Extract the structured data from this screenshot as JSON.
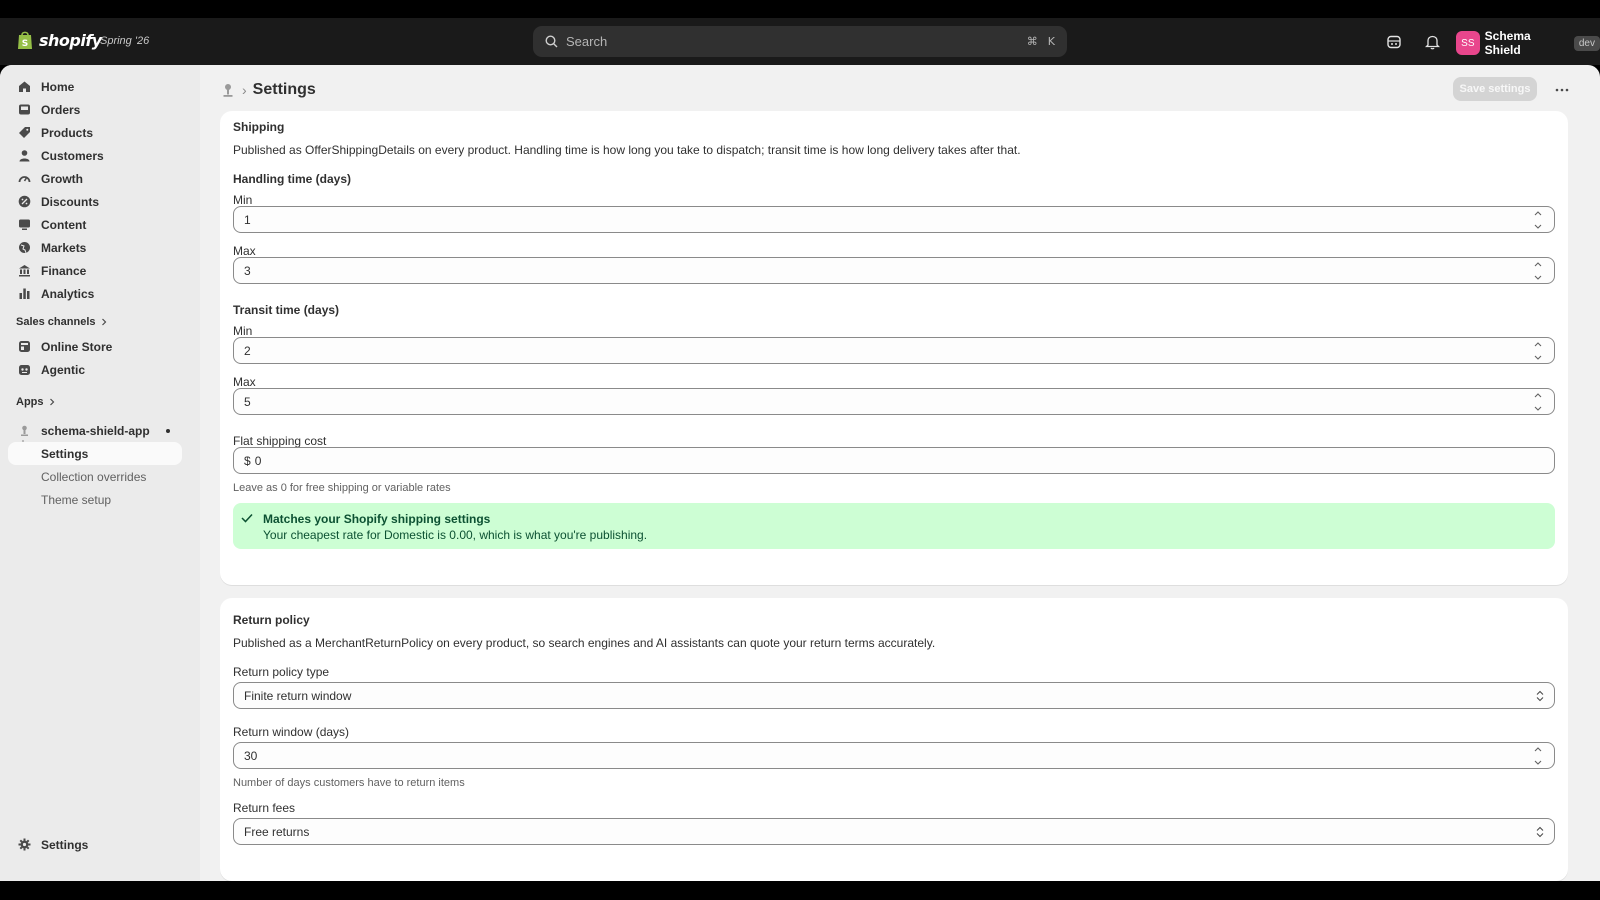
{
  "topbar": {
    "brand": "shopify",
    "edition": "Spring '26",
    "search_placeholder": "Search",
    "shortcut_cmd": "⌘",
    "shortcut_key": "K",
    "user_initials": "SS",
    "user_name": "Schema Shield",
    "user_badge": "dev"
  },
  "sidebar": {
    "items": [
      {
        "label": "Home",
        "icon": "home-icon"
      },
      {
        "label": "Orders",
        "icon": "inbox-icon"
      },
      {
        "label": "Products",
        "icon": "tag-icon"
      },
      {
        "label": "Customers",
        "icon": "person-icon"
      },
      {
        "label": "Growth",
        "icon": "gauge-icon"
      },
      {
        "label": "Discounts",
        "icon": "discount-icon"
      },
      {
        "label": "Content",
        "icon": "monitor-icon"
      },
      {
        "label": "Markets",
        "icon": "globe-icon"
      },
      {
        "label": "Finance",
        "icon": "bank-icon"
      },
      {
        "label": "Analytics",
        "icon": "bar-chart-icon"
      }
    ],
    "sales_channels_label": "Sales channels",
    "channels": [
      {
        "label": "Online Store",
        "icon": "store-icon"
      },
      {
        "label": "Agentic",
        "icon": "robot-icon"
      }
    ],
    "apps_label": "Apps",
    "app_name": "schema-shield-app",
    "app_subitems": [
      "Settings",
      "Collection overrides",
      "Theme setup"
    ],
    "bottom_settings": "Settings"
  },
  "header": {
    "title": "Settings",
    "save_label": "Save settings"
  },
  "shipping": {
    "title": "Shipping",
    "description": "Published as OfferShippingDetails on every product. Handling time is how long you take to dispatch; transit time is how long delivery takes after that.",
    "handling_title": "Handling time (days)",
    "handling_min_label": "Min",
    "handling_min": "1",
    "handling_max_label": "Max",
    "handling_max": "3",
    "transit_title": "Transit time (days)",
    "transit_min_label": "Min",
    "transit_min": "2",
    "transit_max_label": "Max",
    "transit_max": "5",
    "flat_cost_label": "Flat shipping cost",
    "currency_symbol": "$",
    "flat_cost": "0",
    "flat_cost_help": "Leave as 0 for free shipping or variable rates",
    "banner_title": "Matches your Shopify shipping settings",
    "banner_text": "Your cheapest rate for Domestic is 0.00, which is what you're publishing."
  },
  "return_policy": {
    "title": "Return policy",
    "description": "Published as a MerchantReturnPolicy on every product, so search engines and AI assistants can quote your return terms accurately.",
    "type_label": "Return policy type",
    "type_value": "Finite return window",
    "window_label": "Return window (days)",
    "window_value": "30",
    "window_help": "Number of days customers have to return items",
    "fees_label": "Return fees",
    "fees_value": "Free returns"
  },
  "colors": {
    "topbar": "#1a1a1a",
    "accent_avatar": "#e8468c",
    "success_banner": "#cdfed4"
  }
}
